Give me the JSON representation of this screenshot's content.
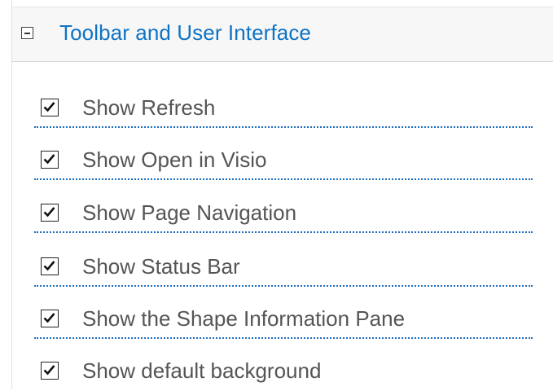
{
  "section": {
    "title": "Toolbar and User Interface",
    "collapse_icon": "minus-box-icon"
  },
  "options": [
    {
      "label": "Show Refresh",
      "checked": true
    },
    {
      "label": "Show Open in Visio",
      "checked": true
    },
    {
      "label": "Show Page Navigation",
      "checked": true
    },
    {
      "label": "Show Status Bar",
      "checked": true
    },
    {
      "label": "Show the Shape Information Pane",
      "checked": true
    },
    {
      "label": "Show default background",
      "checked": true
    }
  ],
  "colors": {
    "title": "#0f73c4",
    "label": "#555555",
    "separator": "#1e6ec0",
    "header_bg": "#f7f7f7"
  }
}
